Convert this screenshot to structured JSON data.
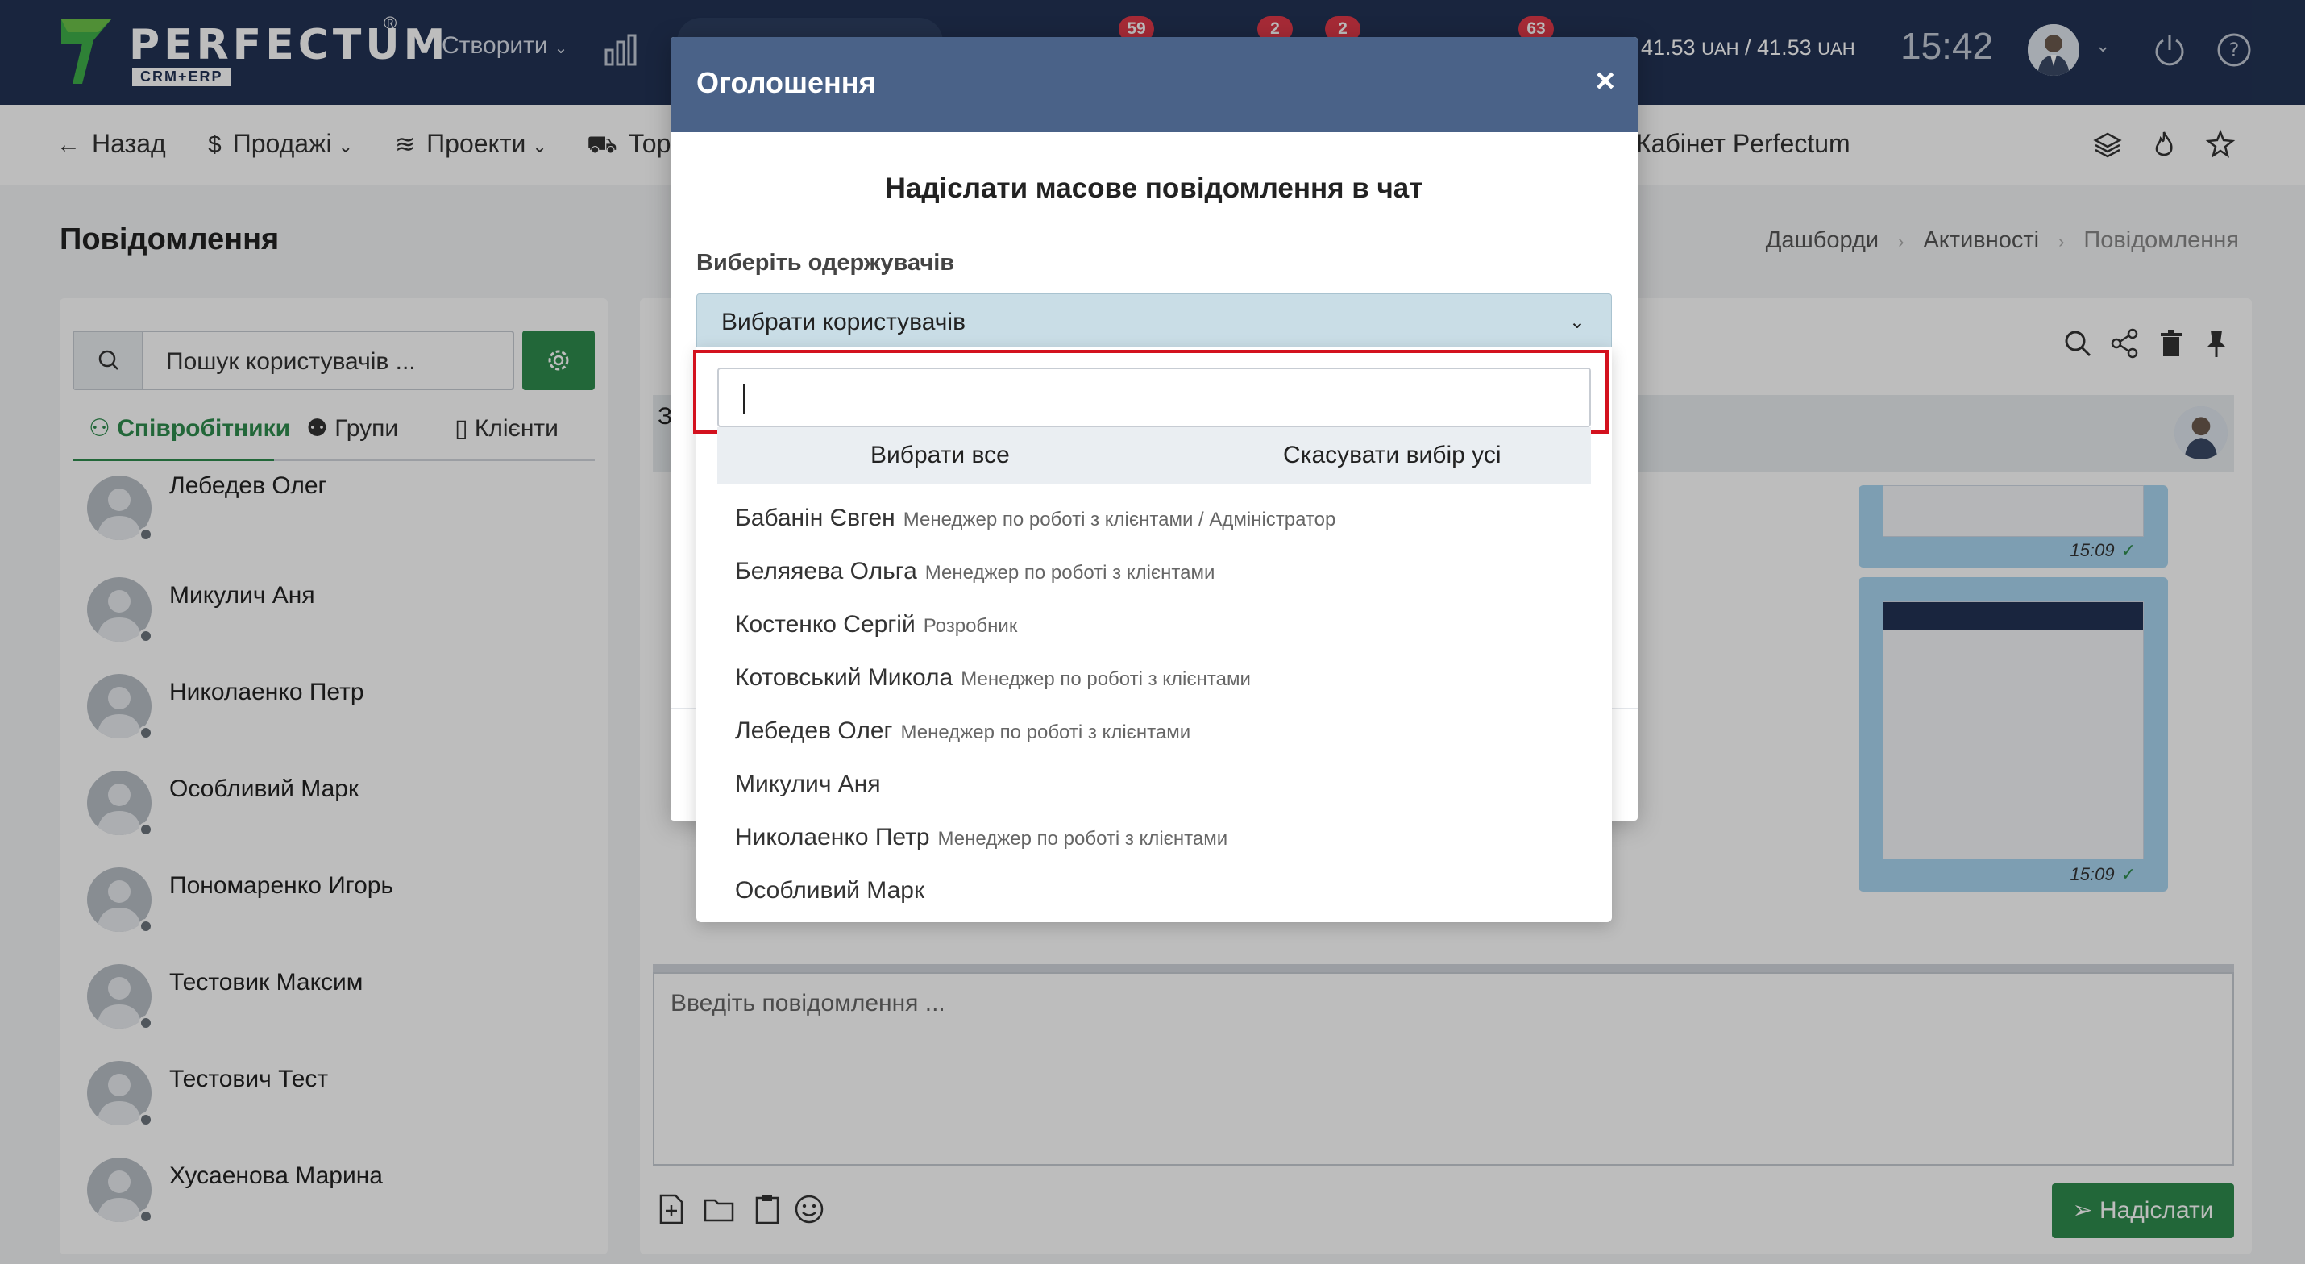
{
  "topbar": {
    "logo_text": "PERFECTUM",
    "logo_reg": "®",
    "logo_sub": "CRM+ERP",
    "create_label": "Створити",
    "badges": [
      "59",
      "2",
      "2",
      "63"
    ],
    "balance_amount1": "41.53",
    "balance_amount2": "41.53",
    "balance_currency": "UAH",
    "balance_sep": " / ",
    "clock": "15:42"
  },
  "navbar": {
    "back": "Назад",
    "sales": "Продажі",
    "projects": "Проекти",
    "goods": "Тор",
    "cabinet": "Кабінет Perfectum"
  },
  "page": {
    "title": "Повідомлення",
    "breadcrumb": [
      "Дашборди",
      "Активності",
      "Повідомлення"
    ]
  },
  "left_panel": {
    "search_placeholder": "Пошук користувачів ...",
    "tabs": [
      "Співробітники",
      "Групи",
      "Клієнти"
    ],
    "users": [
      "Лебедев Олег",
      "Микулич Аня",
      "Николаенко Петр",
      "Особливий Марк",
      "Пономаренко Игорь",
      "Тестовик Максим",
      "Тестович Тест",
      "Хусаенова Марина"
    ]
  },
  "chat": {
    "header_letter": "З",
    "message_times": [
      "15:09",
      "15:09"
    ],
    "input_placeholder": "Введіть повідомлення ...",
    "send_label": "Надіслати"
  },
  "modal": {
    "title": "Оголошення",
    "close": "×",
    "heading": "Надіслати масове повідомлення в чат",
    "field_label": "Виберіть одержувачів",
    "select_value": "Вибрати користувачів",
    "select_all": "Вибрати все",
    "deselect_all": "Скасувати вибір усі",
    "options": [
      {
        "name": "Бабанін Євген",
        "role": "Менеджер по роботі з клієнтами / Адміністратор"
      },
      {
        "name": "Беляяева Ольга",
        "role": "Менеджер по роботі з клієнтами"
      },
      {
        "name": "Костенко Сергій",
        "role": "Розробник"
      },
      {
        "name": "Котовський Микола",
        "role": "Менеджер по роботі з клієнтами"
      },
      {
        "name": "Лебедев Олег",
        "role": "Менеджер по роботі з клієнтами"
      },
      {
        "name": "Микулич Аня",
        "role": ""
      },
      {
        "name": "Николаенко Петр",
        "role": "Менеджер по роботі з клієнтами"
      },
      {
        "name": "Особливий Марк",
        "role": ""
      }
    ]
  },
  "colors": {
    "topbar": "#223354",
    "accent_green": "#2e8b4d",
    "modal_header": "#4a6288",
    "badge_red": "#e0394a",
    "highlight_red": "#d3111e"
  }
}
